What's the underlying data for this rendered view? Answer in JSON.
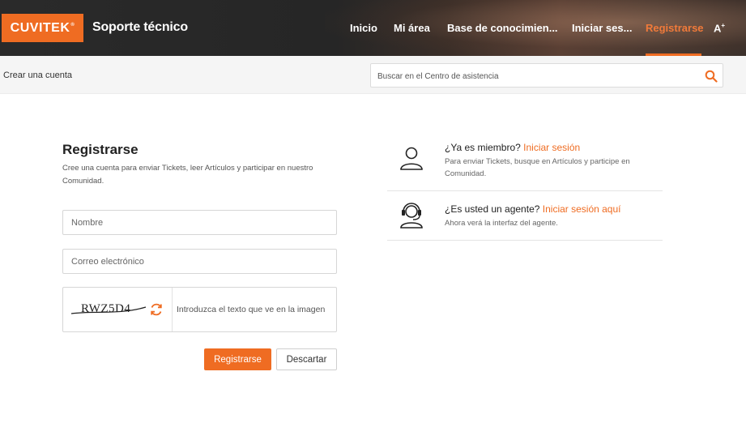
{
  "header": {
    "logo": "CUVITEK",
    "logo_mark": "®",
    "title": "Soporte técnico",
    "nav": [
      {
        "label": "Inicio"
      },
      {
        "label": "Mi área"
      },
      {
        "label": "Base de conocimien..."
      },
      {
        "label": "Iniciar ses..."
      },
      {
        "label": "Registrarse"
      }
    ],
    "font_toggle": "A",
    "font_toggle_sup": "+",
    "accent": "#ef6c22"
  },
  "subbar": {
    "breadcrumb": "Crear una cuenta",
    "search_placeholder": "Buscar en el Centro de asistencia",
    "search_icon": "search-icon"
  },
  "form": {
    "title": "Registrarse",
    "description": "Cree una cuenta para enviar Tickets, leer Artículos y participar en nuestro Comunidad.",
    "name_placeholder": "Nombre",
    "email_placeholder": "Correo electrónico",
    "captcha_text": "RWZ5D4",
    "captcha_placeholder": "Introduzca el texto que ve en la imagen",
    "submit_label": "Registrarse",
    "cancel_label": "Descartar"
  },
  "side": {
    "member": {
      "question": "¿Ya es miembro?",
      "link": "Iniciar sesión",
      "sub": "Para enviar Tickets, busque en Artículos y participe en Comunidad.",
      "icon": "user-icon"
    },
    "agent": {
      "question": "¿Es usted un agente?",
      "link": "Iniciar sesión aquí",
      "sub": "Ahora verá la interfaz del agente.",
      "icon": "headset-icon"
    }
  }
}
